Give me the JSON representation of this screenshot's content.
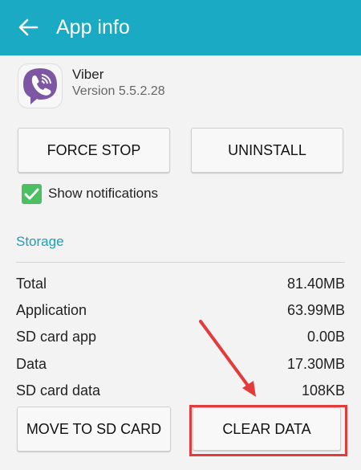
{
  "header": {
    "title": "App info",
    "back_icon": "arrow-left-icon",
    "color": "#1aaac4"
  },
  "app": {
    "name": "Viber",
    "version": "Version 5.5.2.28",
    "icon": "viber-logo",
    "brand_color": "#7d57a4"
  },
  "actions": {
    "force_stop": "FORCE STOP",
    "uninstall": "UNINSTALL"
  },
  "notifications": {
    "label": "Show notifications",
    "checked": true,
    "color": "#4cbf63"
  },
  "storage": {
    "section_title": "Storage",
    "rows": [
      {
        "label": "Total",
        "value": "81.40MB"
      },
      {
        "label": "Application",
        "value": "63.99MB"
      },
      {
        "label": "SD card app",
        "value": "0.00B"
      },
      {
        "label": "Data",
        "value": "17.30MB"
      },
      {
        "label": "SD card data",
        "value": "108KB"
      }
    ],
    "move_button": "MOVE TO SD CARD",
    "clear_button": "CLEAR DATA"
  },
  "annotation": {
    "color": "#e23b3b",
    "arrow": "red-arrow",
    "target": "clear-data-button"
  }
}
